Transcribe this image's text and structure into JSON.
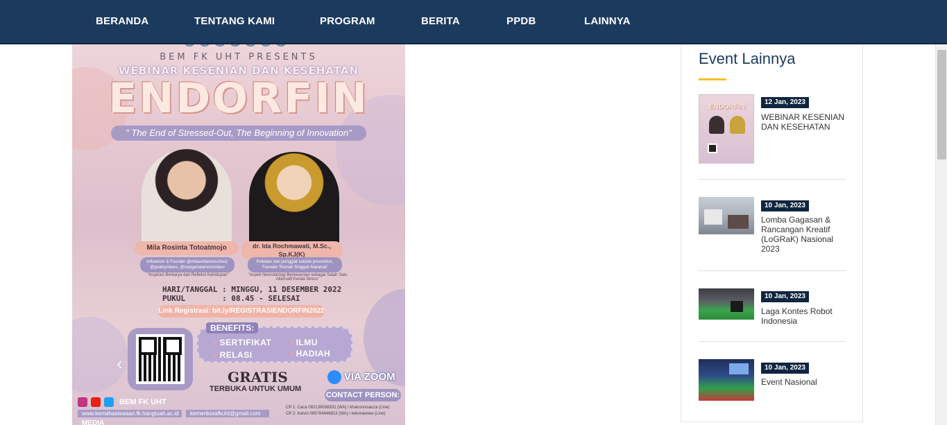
{
  "nav": {
    "items": [
      "BERANDA",
      "TENTANG KAMI",
      "PROGRAM",
      "BERITA",
      "PPDB",
      "LAINNYA"
    ]
  },
  "poster": {
    "presents": "BEM FK UHT PRESENTS",
    "webinar": "WEBINAR KESENIAN DAN KESEHATAN",
    "title": "ENDORFIN",
    "tagline": "\" The End of Stressed-Out, The Beginning of Innovation\"",
    "speaker1_name": "Mila Rosinta Totoatmojo",
    "speaker1_role": "Influencer & Founder @milaartdanceschool, @goalsymilaro, @margariatamorvmilaro",
    "speaker1_quote": "\"Inspirasi Berkarya dari Refleksi Kehidupan\"",
    "speaker2_name": "dr. Ida Rochmawati, M.Sc., Sp.KJ(K)",
    "speaker2_role": "Psikiater dan penggiat suicide prevention, Founder 'Rumah Singgah Matahati'",
    "speaker2_quote": "\"Aspek Neurobiologi Berkesenian sebagai Salah Satu Alternatif Kelola Stress\"",
    "schedule_line1": "HARI/TANGGAL : MINGGU, 11 DESEMBER 2022",
    "schedule_line2": "PUKUL        : 08.45 - SELESAI",
    "registration": "Link Registrasi: bit.ly/REGISTRASIENDORFIN2022",
    "benefits_title": "BENEFITS:",
    "benefits": [
      "SERTIFIKAT",
      "ILMU",
      "RELASI",
      "HADIAH"
    ],
    "gratis": "GRATIS",
    "terbuka": "TERBUKA UNTUK UMUM",
    "via_zoom": "VIA ZOOM",
    "contact_person": "CONTACT PERSON:",
    "cp1": "CP 1: Caca 082139058302 (WA) / khairunnisacca (Line)",
    "cp2": "CP 2: Kelvin 085784846813 (WA) / kelvinawww (Line)",
    "social_name": "BEM FK UHT",
    "website": "www.kemahasiswaan.fk.hangtuah.ac.id",
    "email": "kemenkorafkuht@gmail.com",
    "media": "MEDIA"
  },
  "sidebar": {
    "title": "Event Lainnya",
    "events": [
      {
        "date": "12 Jan, 2023",
        "title": "WEBINAR KESENIAN DAN KESEHATAN",
        "thumb_label": "ENDORFIN"
      },
      {
        "date": "10 Jan, 2023",
        "title": "Lomba Gagasan & Rancangan Kreatif (LoGRaK) Nasional 2023"
      },
      {
        "date": "10 Jan, 2023",
        "title": "Laga Kontes Robot Indonesia"
      },
      {
        "date": "10 Jan, 2023",
        "title": "Event Nasional"
      }
    ]
  },
  "colors": {
    "nav_bg": "#1c3a5e",
    "accent_underline": "#f3c31a",
    "date_badge": "#0f2540"
  }
}
